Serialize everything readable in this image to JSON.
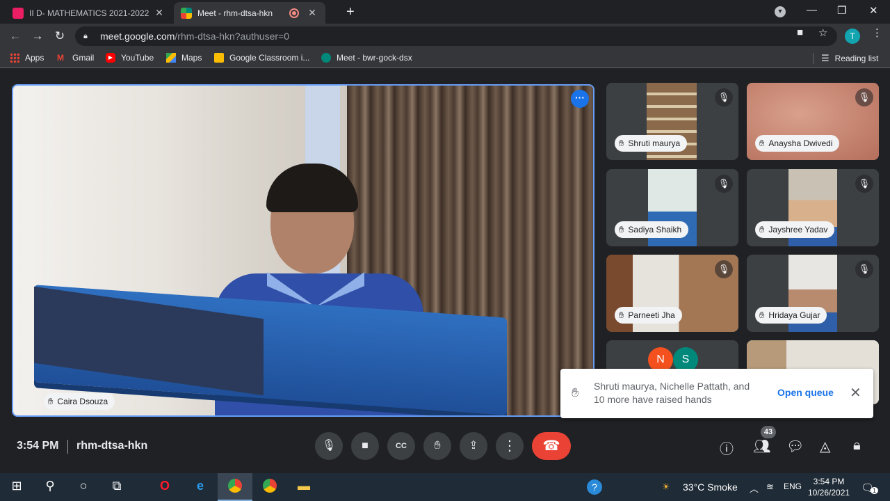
{
  "browser": {
    "tabs": [
      {
        "title": "II D- MATHEMATICS 2021-2022",
        "favicon_color": "#e91e63"
      },
      {
        "title": "Meet - rhm-dtsa-hkn",
        "favicon_color": "#00897b"
      }
    ],
    "url_host": "meet.google.com",
    "url_path": "/rhm-dtsa-hkn?authuser=0",
    "profile_initial": "T",
    "bookmarks": [
      {
        "label": "Apps"
      },
      {
        "label": "Gmail"
      },
      {
        "label": "YouTube"
      },
      {
        "label": "Maps"
      },
      {
        "label": "Google Classroom i..."
      },
      {
        "label": "Meet - bwr-gock-dsx"
      }
    ],
    "reading_list": "Reading list"
  },
  "meet": {
    "main_speaker": "Caira Dsouza",
    "participants": [
      {
        "name": "Shruti maurya"
      },
      {
        "name": "Anaysha Dwivedi"
      },
      {
        "name": "Sadiya Shaikh"
      },
      {
        "name": "Jayshree Yadav"
      },
      {
        "name": "Parneeti Jha"
      },
      {
        "name": "Hridaya Gujar"
      }
    ],
    "avatar_initials": [
      "N",
      "S"
    ],
    "toast": {
      "message": "Shruti maurya, Nichelle Pattath, and 10 more have raised hands",
      "action": "Open queue"
    },
    "time": "3:54 PM",
    "meeting_code": "rhm-dtsa-hkn",
    "participant_count": "43",
    "colors": {
      "accent": "#1a73e8",
      "end_call": "#ea4335",
      "highlight": "#669df6"
    }
  },
  "taskbar": {
    "weather": "33°C  Smoke",
    "language": "ENG",
    "time": "3:54 PM",
    "date": "10/26/2021",
    "notification_count": "1"
  }
}
